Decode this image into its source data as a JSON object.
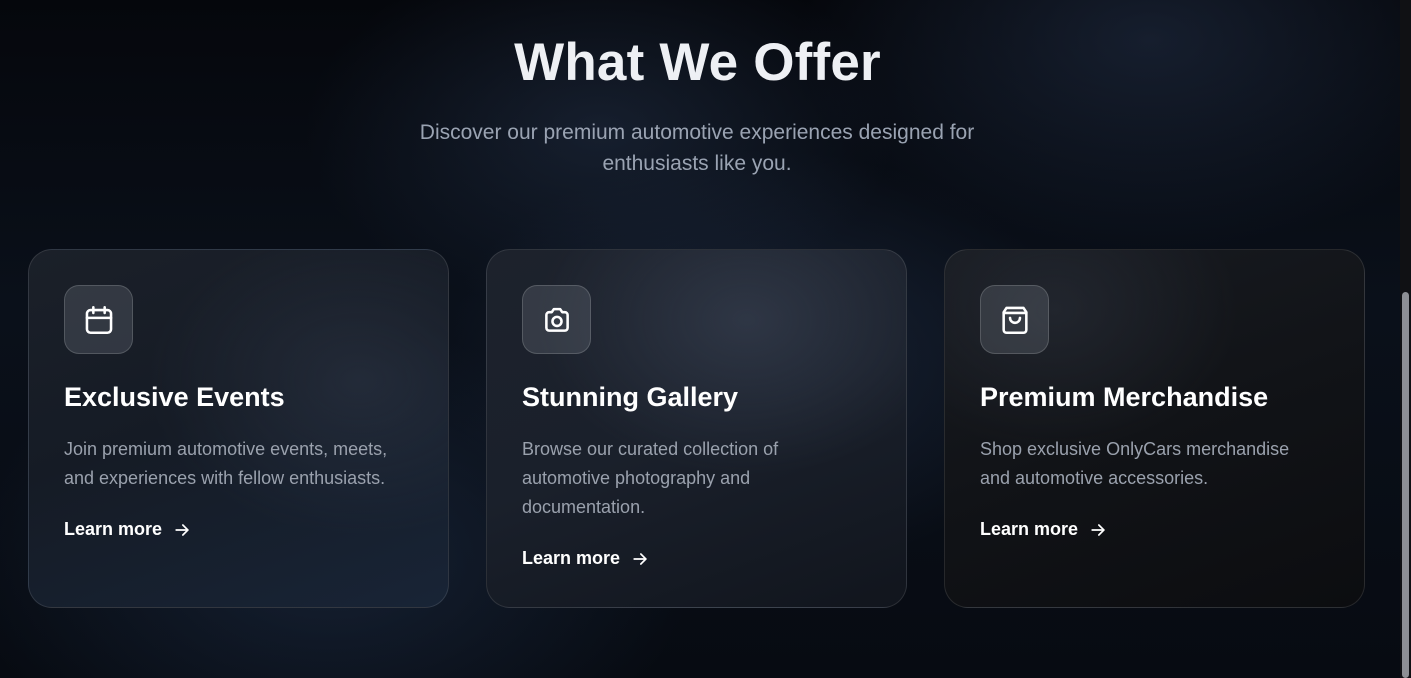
{
  "section": {
    "title": "What We Offer",
    "subtitle": "Discover our premium automotive experiences designed for enthusiasts like you."
  },
  "cards": [
    {
      "icon": "calendar-icon",
      "title": "Exclusive Events",
      "description": "Join premium automotive events, meets, and experiences with fellow enthusiasts.",
      "link_label": "Learn more"
    },
    {
      "icon": "camera-icon",
      "title": "Stunning Gallery",
      "description": "Browse our curated collection of automotive photography and documentation.",
      "link_label": "Learn more"
    },
    {
      "icon": "shopping-bag-icon",
      "title": "Premium Merchandise",
      "description": "Shop exclusive OnlyCars merchandise and automotive accessories.",
      "link_label": "Learn more"
    }
  ],
  "colors": {
    "heading": "#eef0f4",
    "subtitle": "#9aa3b2",
    "card_text": "#9aa1ad",
    "link": "#ffffff"
  }
}
